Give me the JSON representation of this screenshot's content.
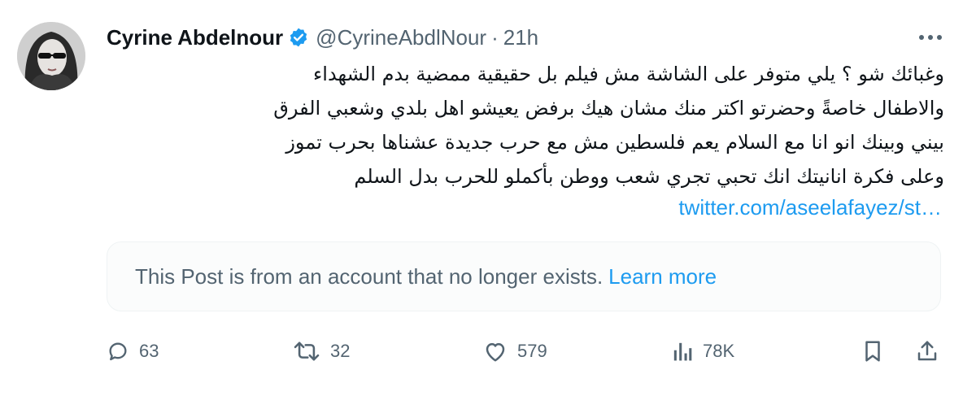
{
  "post": {
    "author_name": "Cyrine Abdelnour",
    "handle": "@CyrineAbdlNour",
    "separator": "·",
    "time": "21h",
    "more_icon": "more-horizontal-icon",
    "verified_icon": "verified-badge-icon",
    "text_lines": [
      "وغبائك شو ؟ يلي متوفر على الشاشة مش فيلم بل حقيقية ممضية بدم الشهداء",
      "والاطفال خاصةً وحضرتو اكتر منك مشان هيك برفض يعيشو اهل بلدي وشعبي الفرق",
      "بيني وبينك انو انا مع السلام يعم فلسطين مش مع حرب جديدة عشناها بحرب تموز",
      "وعلى فكرة انانيتك انك تحبي تجري شعب ووطن بأكملو للحرب بدل السلم"
    ],
    "link": "twitter.com/aseelafayez/st…",
    "quoted_notice": {
      "text": "This Post is from an account that no longer exists.",
      "link": "Learn more"
    },
    "actions": {
      "replies": "63",
      "reposts": "32",
      "likes": "579",
      "views": "78K"
    }
  },
  "colors": {
    "accent": "#1d9bf0",
    "secondary_text": "#536471",
    "primary_text": "#0f1419"
  }
}
